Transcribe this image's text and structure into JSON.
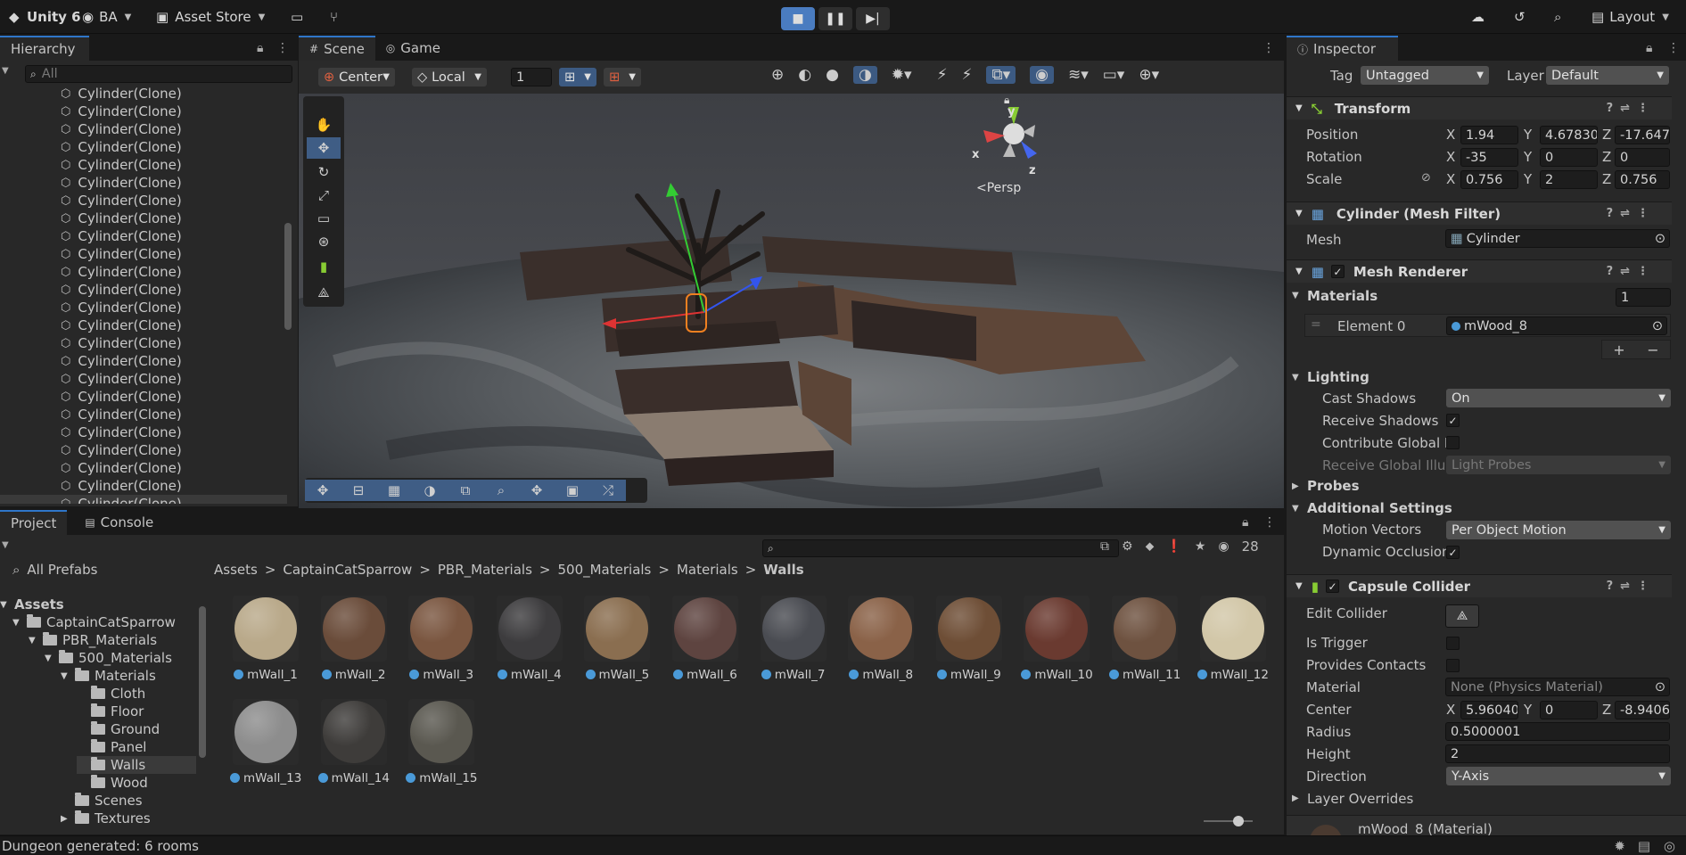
{
  "topbar": {
    "app": "Unity 6",
    "account": "BA",
    "asset_store": "Asset Store",
    "layout": "Layout"
  },
  "hierarchy": {
    "tab": "Hierarchy",
    "search_placeholder": "All",
    "items": [
      "Cylinder(Clone)",
      "Cylinder(Clone)",
      "Cylinder(Clone)",
      "Cylinder(Clone)",
      "Cylinder(Clone)",
      "Cylinder(Clone)",
      "Cylinder(Clone)",
      "Cylinder(Clone)",
      "Cylinder(Clone)",
      "Cylinder(Clone)",
      "Cylinder(Clone)",
      "Cylinder(Clone)",
      "Cylinder(Clone)",
      "Cylinder(Clone)",
      "Cylinder(Clone)",
      "Cylinder(Clone)",
      "Cylinder(Clone)",
      "Cylinder(Clone)",
      "Cylinder(Clone)",
      "Cylinder(Clone)",
      "Cylinder(Clone)",
      "Cylinder(Clone)",
      "Cylinder(Clone)",
      "Cylinder(Clone)"
    ]
  },
  "scene": {
    "tabs": [
      "Scene",
      "Game"
    ],
    "pivot": "Center",
    "space": "Local",
    "grid_snap": "1",
    "persp": "<Persp",
    "gizmo_y": "y",
    "gizmo_x": "x",
    "gizmo_z": "z"
  },
  "inspector": {
    "tab": "Inspector",
    "tag_label": "Tag",
    "tag": "Untagged",
    "layer_label": "Layer",
    "layer": "Default",
    "transform": {
      "title": "Transform",
      "position_label": "Position",
      "pos_x": "1.94",
      "pos_y": "4.67830",
      "pos_z": "-17.647",
      "rotation_label": "Rotation",
      "rot_x": "-35",
      "rot_y": "0",
      "rot_z": "0",
      "scale_label": "Scale",
      "scale_x": "0.756",
      "scale_y": "2",
      "scale_z": "0.756"
    },
    "mesh_filter": {
      "title": "Cylinder (Mesh Filter)",
      "mesh_label": "Mesh",
      "mesh": "Cylinder"
    },
    "mesh_renderer": {
      "title": "Mesh Renderer",
      "materials_label": "Materials",
      "materials_count": "1",
      "element_label": "Element 0",
      "element_value": "mWood_8",
      "lighting_label": "Lighting",
      "cast_shadows_label": "Cast Shadows",
      "cast_shadows": "On",
      "receive_shadows_label": "Receive Shadows",
      "contribute_gi_label": "Contribute Global I",
      "receive_gi_label": "Receive Global Illur",
      "receive_gi": "Light Probes",
      "probes_label": "Probes",
      "additional_label": "Additional Settings",
      "motion_vectors_label": "Motion Vectors",
      "motion_vectors": "Per Object Motion",
      "dynamic_occlusion_label": "Dynamic Occlusion"
    },
    "capsule_collider": {
      "title": "Capsule Collider",
      "edit_collider_label": "Edit Collider",
      "is_trigger_label": "Is Trigger",
      "provides_contacts_label": "Provides Contacts",
      "material_label": "Material",
      "material": "None (Physics Material)",
      "center_label": "Center",
      "center_x": "5.96040",
      "center_y": "0",
      "center_z": "-8.9406",
      "radius_label": "Radius",
      "radius": "0.5000001",
      "height_label": "Height",
      "height": "2",
      "direction_label": "Direction",
      "direction": "Y-Axis",
      "layer_overrides_label": "Layer Overrides"
    },
    "material_footer": "mWood_8 (Material)"
  },
  "project": {
    "tabs": [
      "Project",
      "Console"
    ],
    "count": "28",
    "all_prefabs": "All Prefabs",
    "tree": [
      "Assets",
      "CaptainCatSparrow",
      "PBR_Materials",
      "500_Materials",
      "Materials",
      "Cloth",
      "Floor",
      "Ground",
      "Panel",
      "Walls",
      "Wood",
      "Scenes",
      "Textures"
    ],
    "breadcrumb": [
      "Assets",
      "CaptainCatSparrow",
      "PBR_Materials",
      "500_Materials",
      "Materials",
      "Walls"
    ],
    "materials": [
      "mWall_1",
      "mWall_2",
      "mWall_3",
      "mWall_4",
      "mWall_5",
      "mWall_6",
      "mWall_7",
      "mWall_8",
      "mWall_9",
      "mWall_10",
      "mWall_11",
      "mWall_12",
      "mWall_13",
      "mWall_14",
      "mWall_15"
    ]
  },
  "status": "Dungeon generated: 6 rooms"
}
